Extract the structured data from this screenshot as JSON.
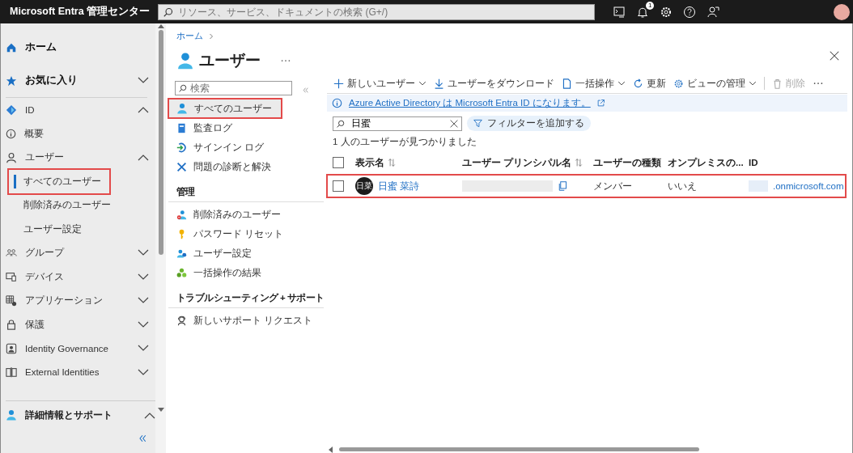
{
  "top_bar": {
    "brand": "Microsoft Entra 管理センター",
    "search_placeholder": "リソース、サービス、ドキュメントの検索 (G+/)",
    "notification_count": "1"
  },
  "left_nav": {
    "items": [
      {
        "label": "ホーム",
        "kind": "top"
      },
      {
        "label": "お気に入り",
        "kind": "top",
        "expanded": false
      },
      {
        "label": "ID",
        "kind": "group",
        "expanded": true
      },
      {
        "label": "概要",
        "kind": "link"
      },
      {
        "label": "ユーザー",
        "kind": "group",
        "expanded": true
      },
      {
        "label": "すべてのユーザー",
        "kind": "sub",
        "selected": true,
        "highlighted": true
      },
      {
        "label": "削除済みのユーザー",
        "kind": "sub",
        "selected": false,
        "highlighted": false
      },
      {
        "label": "ユーザー設定",
        "kind": "sub",
        "selected": false,
        "highlighted": false
      },
      {
        "label": "グループ",
        "kind": "group",
        "expanded": false
      },
      {
        "label": "デバイス",
        "kind": "group",
        "expanded": false
      },
      {
        "label": "アプリケーション",
        "kind": "group",
        "expanded": false
      },
      {
        "label": "保護",
        "kind": "group",
        "expanded": false
      },
      {
        "label": "Identity Governance",
        "kind": "group",
        "expanded": false
      },
      {
        "label": "External Identities",
        "kind": "group",
        "expanded": false
      }
    ],
    "footer": {
      "label": "詳細情報とサポート",
      "expanded": true
    }
  },
  "blade": {
    "breadcrumb": "ホーム",
    "title": "ユーザー",
    "menu": {
      "search_placeholder": "検索",
      "items": [
        {
          "label": "すべてのユーザー",
          "kind": "item",
          "selected": true,
          "highlighted": true
        },
        {
          "label": "監査ログ",
          "kind": "item",
          "selected": false,
          "highlighted": false
        },
        {
          "label": "サインイン ログ",
          "kind": "item",
          "selected": false,
          "highlighted": false
        },
        {
          "label": "問題の診断と解決",
          "kind": "item",
          "selected": false,
          "highlighted": false
        },
        {
          "label": "管理",
          "kind": "section"
        },
        {
          "label": "削除済みのユーザー",
          "kind": "item",
          "selected": false,
          "highlighted": false
        },
        {
          "label": "パスワード リセット",
          "kind": "item",
          "selected": false,
          "highlighted": false
        },
        {
          "label": "ユーザー設定",
          "kind": "item",
          "selected": false,
          "highlighted": false
        },
        {
          "label": "一括操作の結果",
          "kind": "item",
          "selected": false,
          "highlighted": false
        },
        {
          "label": "トラブルシューティング + サポート",
          "kind": "section"
        },
        {
          "label": "新しいサポート リクエスト",
          "kind": "item",
          "selected": false,
          "highlighted": false
        }
      ]
    },
    "toolbar": [
      {
        "label": "新しいユーザー",
        "dropdown": true,
        "disabled": false
      },
      {
        "label": "ユーザーをダウンロード",
        "dropdown": false,
        "disabled": false
      },
      {
        "label": "一括操作",
        "dropdown": true,
        "disabled": false
      },
      {
        "label": "更新",
        "dropdown": false,
        "disabled": false
      },
      {
        "label": "ビューの管理",
        "dropdown": true,
        "disabled": false
      },
      {
        "label": "削除",
        "dropdown": false,
        "disabled": true
      }
    ],
    "banner": "Azure Active Directory は Microsoft Entra ID になります。",
    "filter": {
      "value": "日蜜",
      "add_filter": "フィルターを追加する"
    },
    "result_count": "1 人のユーザーが見つかりました",
    "table": {
      "select_all_checked": false,
      "columns": [
        {
          "label": "表示名",
          "sortable": true
        },
        {
          "label": "ユーザー プリンシパル名",
          "sortable": true
        },
        {
          "label": "ユーザーの種類",
          "sortable": false
        },
        {
          "label": "オンプレミスの...",
          "sortable": false
        },
        {
          "label": "ID",
          "sortable": false
        }
      ],
      "rows": [
        {
          "checked": false,
          "highlighted": true,
          "initials": "日菜",
          "name": "日蜜 菜詩",
          "user_type": "メンバー",
          "on_premises": "いいえ",
          "id": ".onmicrosoft.com"
        }
      ]
    }
  }
}
